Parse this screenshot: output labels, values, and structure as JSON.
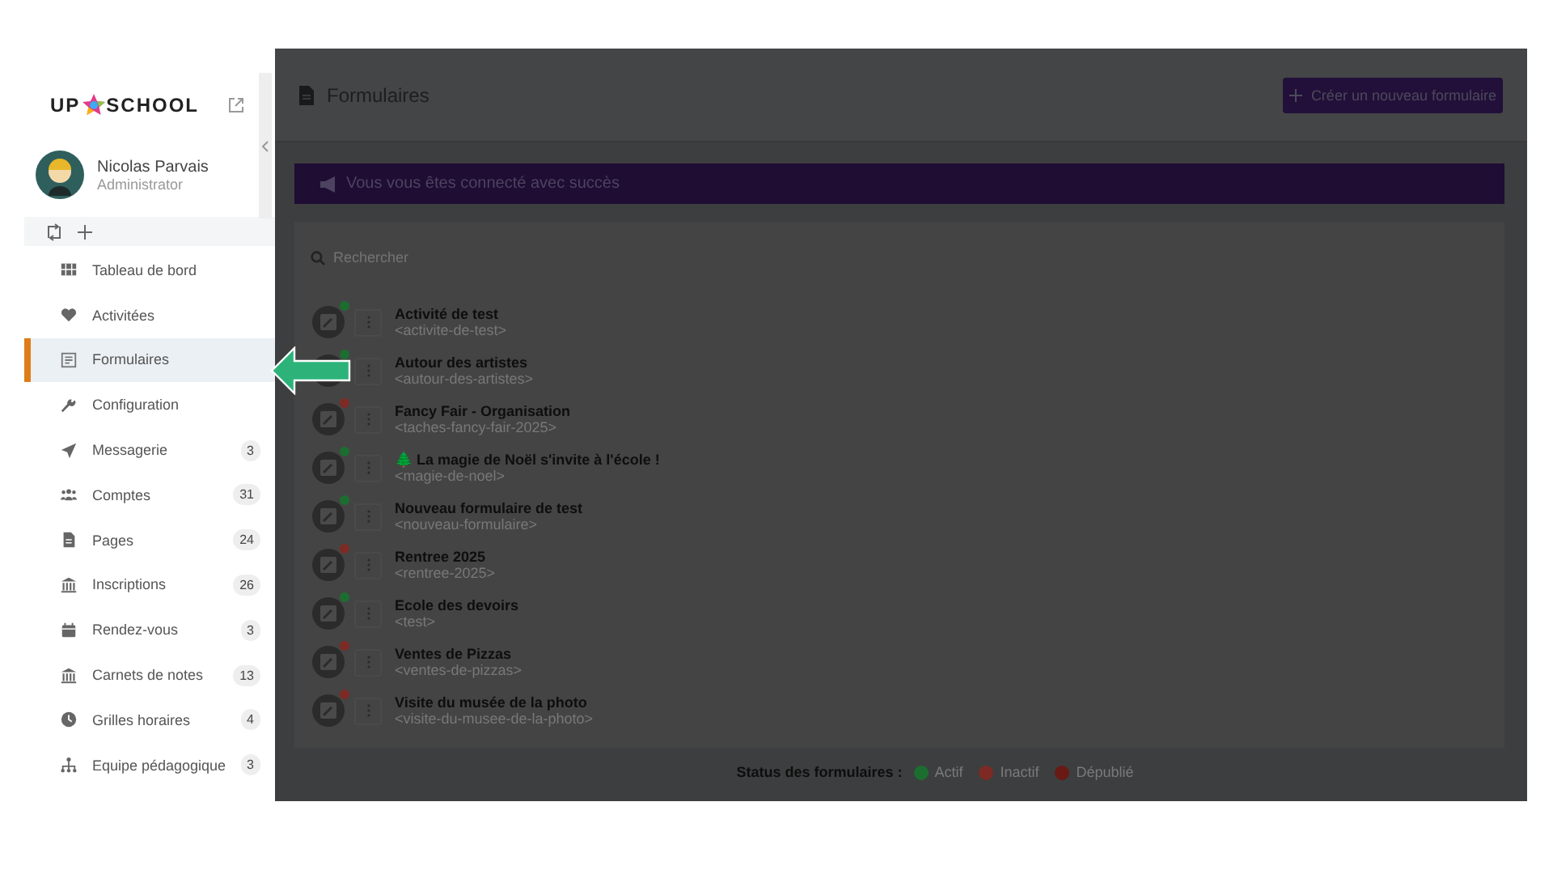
{
  "sidebar": {
    "logo": {
      "left": "UP",
      "right": "SCHOOL"
    },
    "user": {
      "name": "Nicolas Parvais",
      "role": "Administrator"
    },
    "items": [
      {
        "label": "Tableau de bord",
        "selected": false
      },
      {
        "label": "Activitées",
        "selected": false
      },
      {
        "label": "Formulaires",
        "selected": true
      },
      {
        "label": "Configuration",
        "selected": false
      },
      {
        "label": "Messagerie",
        "selected": false,
        "count": "3"
      },
      {
        "label": "Comptes",
        "selected": false,
        "count": "31"
      },
      {
        "label": "Pages",
        "selected": false,
        "count": "24"
      },
      {
        "label": "Inscriptions",
        "selected": false,
        "count": "26"
      },
      {
        "label": "Rendez-vous",
        "selected": false,
        "count": "3"
      },
      {
        "label": "Carnets de notes",
        "selected": false,
        "count": "13"
      },
      {
        "label": "Grilles horaires",
        "selected": false,
        "count": "4"
      },
      {
        "label": "Equipe pédagogique",
        "selected": false,
        "count": "3"
      }
    ]
  },
  "header": {
    "title": "Formulaires",
    "button": "Créer un nouveau formulaire"
  },
  "banner": "Vous vous êtes connecté avec succès",
  "search": {
    "placeholder": "Rechercher"
  },
  "forms": [
    {
      "title": "Activité de test",
      "slug": "<activite-de-test>",
      "color": "#1c6e30"
    },
    {
      "title": "Autour des artistes",
      "slug": "<autour-des-artistes>",
      "color": "#1c6e30"
    },
    {
      "title": "Fancy Fair - Organisation",
      "slug": "<taches-fancy-fair-2025>",
      "color": "#7e2a24"
    },
    {
      "title": "🌲 La magie de Noël s'invite à l'école !",
      "slug": "<magie-de-noel>",
      "color": "#1c6e30"
    },
    {
      "title": "Nouveau formulaire de test",
      "slug": "<nouveau-formulaire>",
      "color": "#1c6e30"
    },
    {
      "title": "Rentree 2025",
      "slug": "<rentree-2025>",
      "color": "#7e2a24"
    },
    {
      "title": "Ecole des devoirs",
      "slug": "<test>",
      "color": "#1c6e30"
    },
    {
      "title": "Ventes de Pizzas",
      "slug": "<ventes-de-pizzas>",
      "color": "#7e2a24"
    },
    {
      "title": "Visite du musée de la photo",
      "slug": "<visite-du-musee-de-la-photo>",
      "color": "#7e2a24"
    }
  ],
  "legend": {
    "label": "Status des formulaires :",
    "items": [
      {
        "label": "Actif",
        "color": "#1c6e30"
      },
      {
        "label": "Inactif",
        "color": "#7e2a24"
      },
      {
        "label": "Dépublié",
        "color": "#6a1a14"
      }
    ]
  }
}
